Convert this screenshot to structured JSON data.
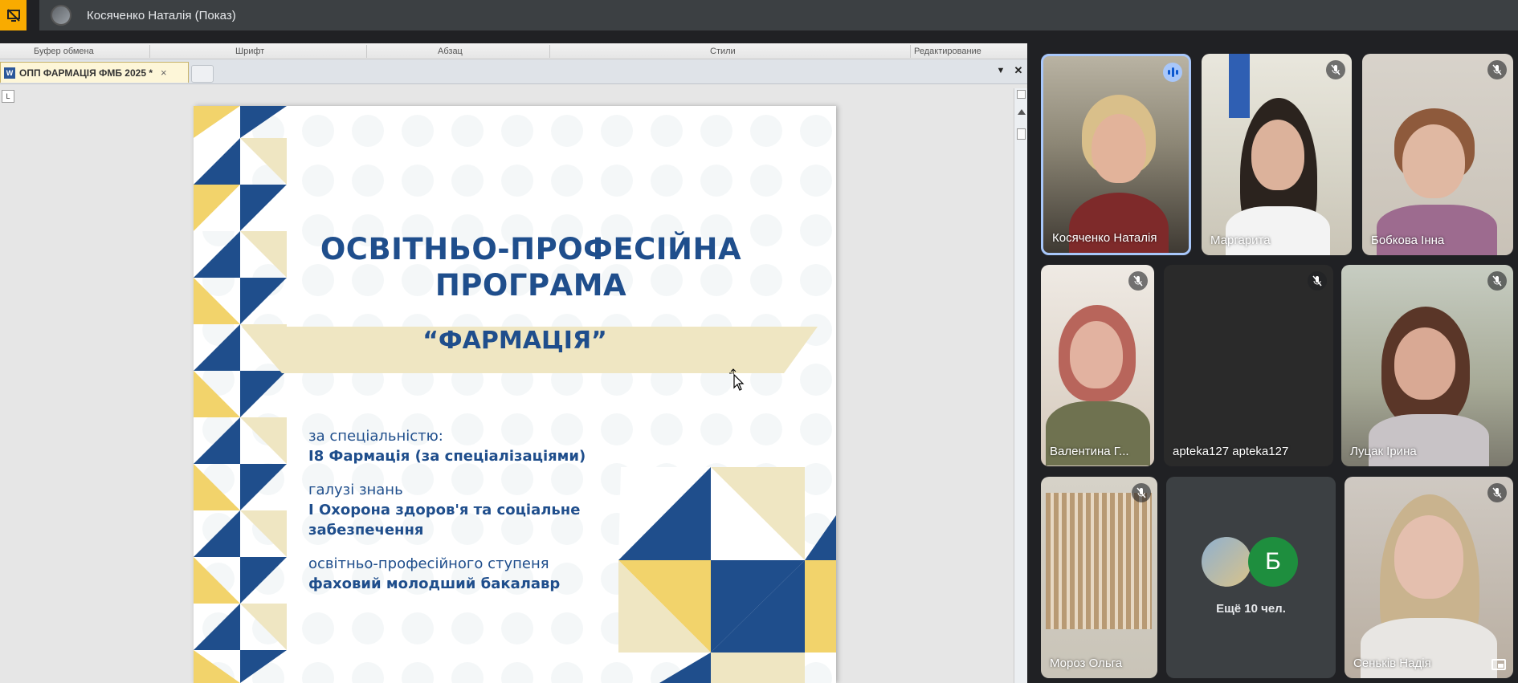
{
  "presenter_bar": {
    "icon": "presentation-off-icon",
    "name": "Косяченко Наталія (Показ)"
  },
  "word": {
    "ribbon_groups": [
      "Буфер обмена",
      "Шрифт",
      "Абзац",
      "Стили",
      "Редактирование"
    ],
    "tab_title": "ОПП ФАРМАЦІЯ ФМБ 2025 *",
    "tab_close": "×",
    "ruler_button": "L",
    "document": {
      "title_line1": "ОСВІТНЬО-ПРОФЕСІЙНА",
      "title_line2": "ПРОГРАМА",
      "subtitle": "“ФАРМАЦІЯ”",
      "specialty_label": "за спеціальністю:",
      "specialty_value": "І8 Фармація (за спеціалізаціями)",
      "field_label": "галузі знань",
      "field_value_line1": "І Охорона здоров'я та соціальне",
      "field_value_line2": "забезпечення",
      "degree_label": "освітньо-професійного ступеня",
      "degree_value": "фаховий молодший бакалавр"
    },
    "colors": {
      "blue": "#1f4e8c",
      "yellow": "#f2d36b",
      "beige": "#efe6c2"
    }
  },
  "participants": [
    {
      "name": "Косяченко Наталія",
      "state": "speaking"
    },
    {
      "name": "Маргарита",
      "state": "muted"
    },
    {
      "name": "Бобкова Інна",
      "state": "muted"
    },
    {
      "name": "Валентина Г...",
      "state": "muted"
    },
    {
      "name": "apteka127 apteka127",
      "state": "muted"
    },
    {
      "name": "Луцак Ірина",
      "state": "muted"
    },
    {
      "name": "Мороз Ольга",
      "state": "muted"
    },
    {
      "name": "Сеньків Надія",
      "state": "muted"
    }
  ],
  "more_tile": {
    "label": "Ещё 10 чел.",
    "letter_avatar": "Б",
    "avatar_color": "#1e8e3e"
  }
}
